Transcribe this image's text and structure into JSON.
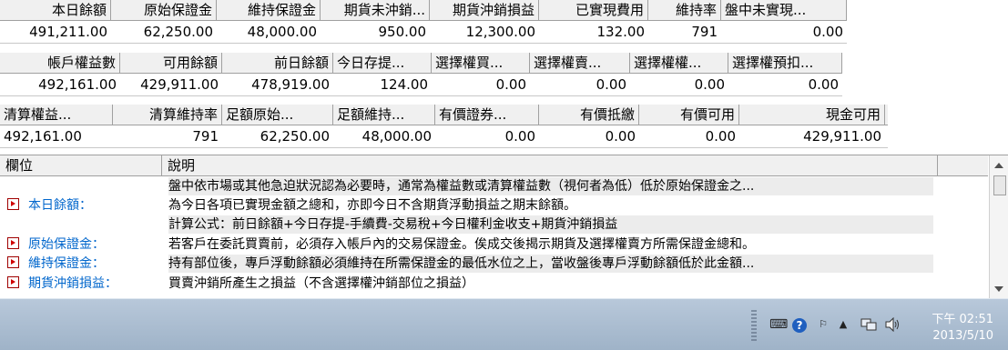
{
  "row1": {
    "headers": [
      "本日餘額",
      "原始保證金",
      "維持保證金",
      "期貨未沖銷...",
      "期貨沖銷損益",
      "已實現費用",
      "維持率",
      "盤中未實現..."
    ],
    "values": [
      "491,211.00",
      "62,250.00",
      "48,000.00",
      "950.00",
      "12,300.00",
      "132.00",
      "791",
      "0.00"
    ]
  },
  "row2": {
    "headers": [
      "帳戶權益數",
      "可用餘額",
      "前日餘額",
      "今日存提...",
      "選擇權買...",
      "選擇權賣...",
      "選擇權權...",
      "選擇權預扣..."
    ],
    "values": [
      "492,161.00",
      "429,911.00",
      "478,919.00",
      "124.00",
      "0.00",
      "0.00",
      "0.00",
      "0.00"
    ]
  },
  "row3": {
    "headers": [
      "清算權益...",
      "清算維持率",
      "足額原始...",
      "足額維持...",
      "有價證券...",
      "有價抵繳",
      "有價可用",
      "現金可用"
    ],
    "values": [
      "492,161.00",
      "791",
      "62,250.00",
      "48,000.00",
      "0.00",
      "0.00",
      "0.00",
      "429,911.00"
    ]
  },
  "description": {
    "col_field": "欄位",
    "col_desc": "說明",
    "rows": [
      {
        "field": "",
        "text": "盤中依市場或其他急迫狀況認為必要時，通常為權益數或清算權益數（視何者為低）低於原始保證金之..."
      },
      {
        "field": "本日餘額：",
        "text": "為今日各項已實現金額之總和，亦即今日不含期貨浮動損益之期末餘額。"
      },
      {
        "field": "",
        "text": "計算公式：前日餘額+今日存提-手續費-交易稅+今日權利金收支+期貨沖銷損益"
      },
      {
        "field": "原始保證金：",
        "text": "若客戶在委託買賣前，必須存入帳戶內的交易保證金。俟成交後揭示期貨及選擇權賣方所需保證金總和。"
      },
      {
        "field": "維持保證金：",
        "text": "持有部位後，專戶浮動餘額必須維持在所需保證金的最低水位之上，當收盤後專戶浮動餘額低於此金額..."
      },
      {
        "field": "期貨沖銷損益：",
        "text": "買賣沖銷所產生之損益（不含選擇權沖銷部位之損益）"
      }
    ]
  },
  "taskbar": {
    "clock_period": "下午 02:51",
    "clock_date": "2013/5/10",
    "icons": [
      "keyboard-icon",
      "help-icon",
      "flag-icon",
      "show-hidden-icons",
      "network-icon",
      "volume-icon"
    ]
  }
}
